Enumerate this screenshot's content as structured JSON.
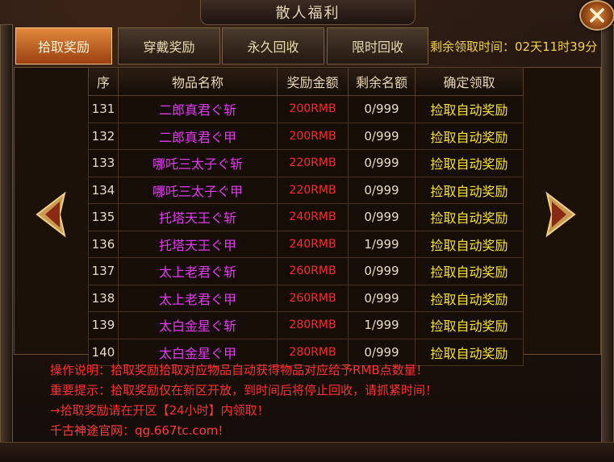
{
  "window": {
    "title": "散人福利",
    "close_icon": "close-x-icon"
  },
  "tabs": [
    {
      "label": "拾取奖励",
      "active": true
    },
    {
      "label": "穿戴奖励",
      "active": false
    },
    {
      "label": "永久回收",
      "active": false
    },
    {
      "label": "限时回收",
      "active": false
    }
  ],
  "remaining_time": "剩余领取时间：02天11时39分",
  "table": {
    "headers": [
      "序",
      "物品名称",
      "奖励金额",
      "剩余名额",
      "确定领取"
    ],
    "rows": [
      {
        "no": "131",
        "name": "二郎真君ぐ斩",
        "amount": "200RMB",
        "remaining": "0/999",
        "action": "捡取自动奖励"
      },
      {
        "no": "132",
        "name": "二郎真君ぐ甲",
        "amount": "200RMB",
        "remaining": "0/999",
        "action": "捡取自动奖励"
      },
      {
        "no": "133",
        "name": "哪吒三太子ぐ斩",
        "amount": "220RMB",
        "remaining": "0/999",
        "action": "捡取自动奖励"
      },
      {
        "no": "134",
        "name": "哪吒三太子ぐ甲",
        "amount": "220RMB",
        "remaining": "0/999",
        "action": "捡取自动奖励"
      },
      {
        "no": "135",
        "name": "托塔天王ぐ斩",
        "amount": "240RMB",
        "remaining": "0/999",
        "action": "捡取自动奖励"
      },
      {
        "no": "136",
        "name": "托塔天王ぐ甲",
        "amount": "240RMB",
        "remaining": "1/999",
        "action": "捡取自动奖励"
      },
      {
        "no": "137",
        "name": "太上老君ぐ斩",
        "amount": "260RMB",
        "remaining": "0/999",
        "action": "捡取自动奖励"
      },
      {
        "no": "138",
        "name": "太上老君ぐ甲",
        "amount": "260RMB",
        "remaining": "0/999",
        "action": "捡取自动奖励"
      },
      {
        "no": "139",
        "name": "太白金星ぐ斩",
        "amount": "280RMB",
        "remaining": "1/999",
        "action": "捡取自动奖励"
      },
      {
        "no": "140",
        "name": "太白金星ぐ甲",
        "amount": "280RMB",
        "remaining": "0/999",
        "action": "捡取自动奖励"
      }
    ]
  },
  "nav": {
    "prev_icon": "left-arrow-icon",
    "next_icon": "right-arrow-icon"
  },
  "notes": {
    "line1": "操作说明：拾取奖励拾取对应物品自动获得物品对应给予RMB点数量！",
    "line2": "重要提示：拾取奖励仅在新区开放，到时间后将停止回收，请抓紧时间！",
    "line3": "→拾取奖励请在开区【24小时】内领取！",
    "line4": "千古神途官网：qg.667tc.com!"
  },
  "colors": {
    "item_name": "#e13bf2",
    "amount": "#ff2a2a",
    "action": "#f5e13a",
    "notes": "#ff3030",
    "active_tab": "#d4702a"
  }
}
